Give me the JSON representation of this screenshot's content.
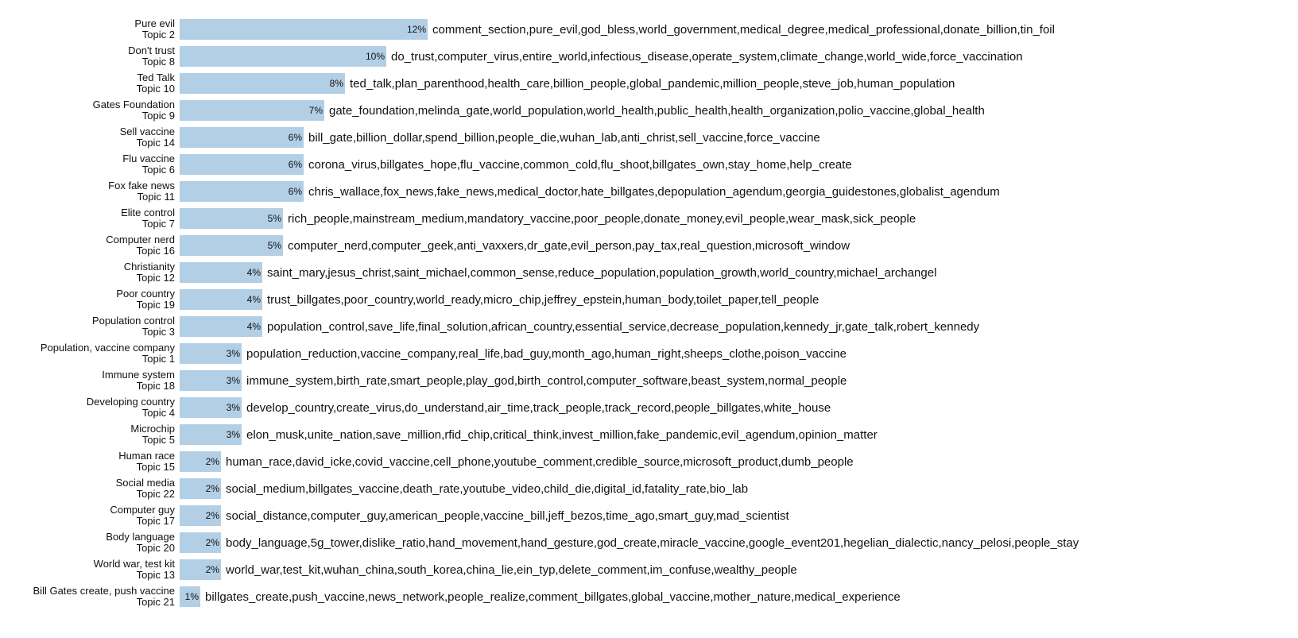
{
  "chart_data": {
    "type": "bar",
    "orientation": "horizontal",
    "xlim": [
      0,
      12
    ],
    "bar_color": "#b2cfe6",
    "bars": [
      {
        "title": "Pure evil",
        "topic": "Topic 2",
        "pct": 12,
        "pct_label": "12%",
        "terms": "comment_section,pure_evil,god_bless,world_government,medical_degree,medical_professional,donate_billion,tin_foil"
      },
      {
        "title": "Don't trust",
        "topic": "Topic 8",
        "pct": 10,
        "pct_label": "10%",
        "terms": "do_trust,computer_virus,entire_world,infectious_disease,operate_system,climate_change,world_wide,force_vaccination"
      },
      {
        "title": "Ted Talk",
        "topic": "Topic 10",
        "pct": 8,
        "pct_label": "8%",
        "terms": "ted_talk,plan_parenthood,health_care,billion_people,global_pandemic,million_people,steve_job,human_population"
      },
      {
        "title": "Gates Foundation",
        "topic": "Topic 9",
        "pct": 7,
        "pct_label": "7%",
        "terms": "gate_foundation,melinda_gate,world_population,world_health,public_health,health_organization,polio_vaccine,global_health"
      },
      {
        "title": "Sell vaccine",
        "topic": "Topic 14",
        "pct": 6,
        "pct_label": "6%",
        "terms": "bill_gate,billion_dollar,spend_billion,people_die,wuhan_lab,anti_christ,sell_vaccine,force_vaccine"
      },
      {
        "title": "Flu vaccine",
        "topic": "Topic 6",
        "pct": 6,
        "pct_label": "6%",
        "terms": "corona_virus,billgates_hope,flu_vaccine,common_cold,flu_shoot,billgates_own,stay_home,help_create"
      },
      {
        "title": "Fox fake news",
        "topic": "Topic 11",
        "pct": 6,
        "pct_label": "6%",
        "terms": "chris_wallace,fox_news,fake_news,medical_doctor,hate_billgates,depopulation_agendum,georgia_guidestones,globalist_agendum"
      },
      {
        "title": "Elite control",
        "topic": "Topic 7",
        "pct": 5,
        "pct_label": "5%",
        "terms": "rich_people,mainstream_medium,mandatory_vaccine,poor_people,donate_money,evil_people,wear_mask,sick_people"
      },
      {
        "title": "Computer nerd",
        "topic": "Topic 16",
        "pct": 5,
        "pct_label": "5%",
        "terms": "computer_nerd,computer_geek,anti_vaxxers,dr_gate,evil_person,pay_tax,real_question,microsoft_window"
      },
      {
        "title": "Christianity",
        "topic": "Topic 12",
        "pct": 4,
        "pct_label": "4%",
        "terms": "saint_mary,jesus_christ,saint_michael,common_sense,reduce_population,population_growth,world_country,michael_archangel"
      },
      {
        "title": "Poor country",
        "topic": "Topic 19",
        "pct": 4,
        "pct_label": "4%",
        "terms": "trust_billgates,poor_country,world_ready,micro_chip,jeffrey_epstein,human_body,toilet_paper,tell_people"
      },
      {
        "title": "Population control",
        "topic": "Topic 3",
        "pct": 4,
        "pct_label": "4%",
        "terms": "population_control,save_life,final_solution,african_country,essential_service,decrease_population,kennedy_jr,gate_talk,robert_kennedy"
      },
      {
        "title": "Population, vaccine company",
        "topic": "Topic 1",
        "pct": 3,
        "pct_label": "3%",
        "terms": "population_reduction,vaccine_company,real_life,bad_guy,month_ago,human_right,sheeps_clothe,poison_vaccine"
      },
      {
        "title": "Immune system",
        "topic": "Topic 18",
        "pct": 3,
        "pct_label": "3%",
        "terms": "immune_system,birth_rate,smart_people,play_god,birth_control,computer_software,beast_system,normal_people"
      },
      {
        "title": "Developing country",
        "topic": "Topic 4",
        "pct": 3,
        "pct_label": "3%",
        "terms": "develop_country,create_virus,do_understand,air_time,track_people,track_record,people_billgates,white_house"
      },
      {
        "title": "Microchip",
        "topic": "Topic 5",
        "pct": 3,
        "pct_label": "3%",
        "terms": "elon_musk,unite_nation,save_million,rfid_chip,critical_think,invest_million,fake_pandemic,evil_agendum,opinion_matter"
      },
      {
        "title": "Human race",
        "topic": "Topic 15",
        "pct": 2,
        "pct_label": "2%",
        "terms": "human_race,david_icke,covid_vaccine,cell_phone,youtube_comment,credible_source,microsoft_product,dumb_people"
      },
      {
        "title": "Social media",
        "topic": "Topic 22",
        "pct": 2,
        "pct_label": "2%",
        "terms": "social_medium,billgates_vaccine,death_rate,youtube_video,child_die,digital_id,fatality_rate,bio_lab"
      },
      {
        "title": "Computer guy",
        "topic": "Topic 17",
        "pct": 2,
        "pct_label": "2%",
        "terms": "social_distance,computer_guy,american_people,vaccine_bill,jeff_bezos,time_ago,smart_guy,mad_scientist"
      },
      {
        "title": "Body language",
        "topic": "Topic 20",
        "pct": 2,
        "pct_label": "2%",
        "terms": "body_language,5g_tower,dislike_ratio,hand_movement,hand_gesture,god_create,miracle_vaccine,google_event201,hegelian_dialectic,nancy_pelosi,people_stay"
      },
      {
        "title": "World war, test kit",
        "topic": "Topic 13",
        "pct": 2,
        "pct_label": "2%",
        "terms": "world_war,test_kit,wuhan_china,south_korea,china_lie,ein_typ,delete_comment,im_confuse,wealthy_people"
      },
      {
        "title": "Bill Gates create, push vaccine",
        "topic": "Topic 21",
        "pct": 1,
        "pct_label": "1%",
        "terms": "billgates_create,push_vaccine,news_network,people_realize,comment_billgates,global_vaccine,mother_nature,medical_experience"
      }
    ]
  }
}
